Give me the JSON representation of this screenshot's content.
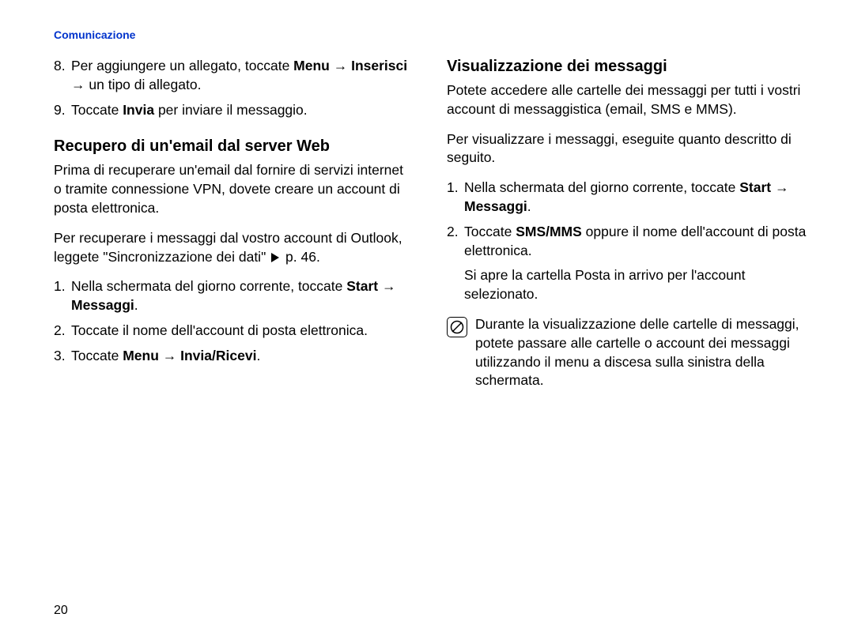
{
  "header": {
    "section": "Comunicazione"
  },
  "pageNumber": "20",
  "left": {
    "step8": {
      "prefix": "Per aggiungere un allegato, toccate ",
      "bold1": "Menu",
      "arrow1": " → ",
      "bold2": "Inserisci",
      "arrow2": " → ",
      "suffix": "un tipo di allegato."
    },
    "step9": {
      "prefix": "Toccate ",
      "bold": "Invia",
      "suffix": " per inviare il messaggio."
    },
    "heading1": "Recupero di un'email dal server Web",
    "para1": "Prima di recuperare un'email dal fornire di servizi internet o tramite connessione VPN, dovete creare un account di posta elettronica.",
    "para2_pre": "Per recuperare i messaggi dal vostro account di Outlook, leggete \"Sincronizzazione dei dati\" ",
    "para2_post": " p. 46.",
    "step1": {
      "prefix": "Nella schermata del giorno corrente, toccate ",
      "bold1": "Start",
      "arrow": " → ",
      "bold2": "Messaggi",
      "suffix": "."
    },
    "step2": "Toccate il nome dell'account di posta elettronica.",
    "step3": {
      "prefix": "Toccate ",
      "bold1": "Menu",
      "arrow": " → ",
      "bold2": "Invia/Ricevi",
      "suffix": "."
    }
  },
  "right": {
    "heading": "Visualizzazione dei messaggi",
    "para1": "Potete accedere alle cartelle dei messaggi per tutti i vostri account di messaggistica (email, SMS e MMS).",
    "para2": "Per visualizzare i messaggi, eseguite quanto descritto di seguito.",
    "step1": {
      "prefix": "Nella schermata del giorno corrente, toccate ",
      "bold1": "Start",
      "arrow": " → ",
      "bold2": "Messaggi",
      "suffix": "."
    },
    "step2": {
      "prefix": "Toccate ",
      "bold": "SMS/MMS",
      "suffix": " oppure il nome dell'account di posta elettronica."
    },
    "para3": "Si apre la cartella Posta in arrivo per l'account selezionato.",
    "note": "Durante la visualizzazione delle cartelle di messaggi, potete passare alle cartelle o account dei messaggi utilizzando il menu a discesa sulla sinistra della schermata."
  }
}
